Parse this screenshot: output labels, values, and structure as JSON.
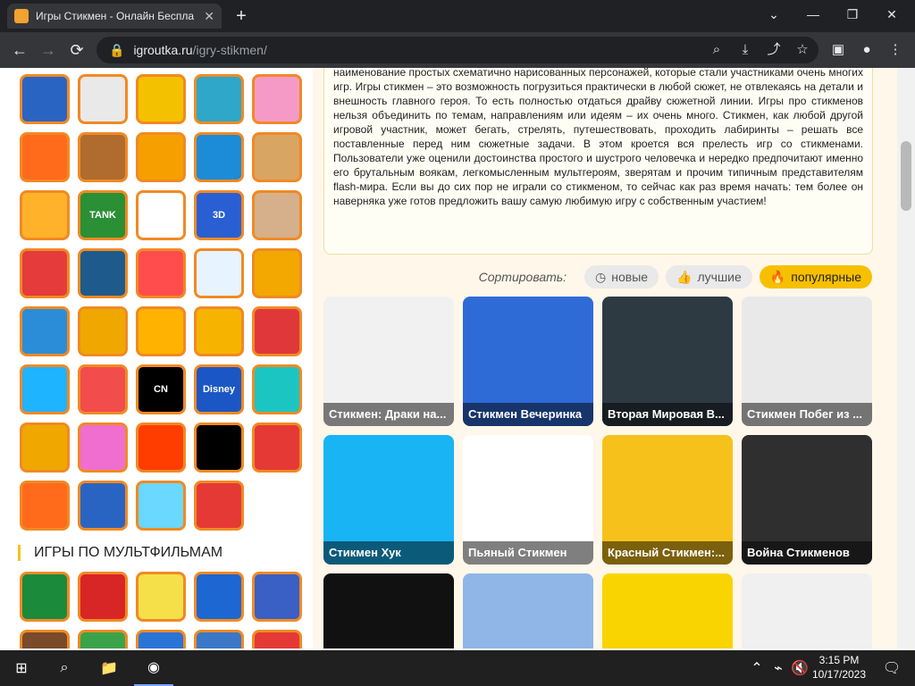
{
  "browser": {
    "tab_title": "Игры Стикмен - Онлайн Беспла",
    "url_host": "igroutka.ru",
    "url_path": "/igry-stikmen/"
  },
  "left": {
    "section_title": "ИГРЫ ПО МУЛЬТФИЛЬМАМ",
    "tiles": [
      {
        "label": "",
        "color": "#2a64c3"
      },
      {
        "label": "",
        "color": "#e9e9e9"
      },
      {
        "label": "",
        "color": "#f4c100"
      },
      {
        "label": "",
        "color": "#2ea7c9"
      },
      {
        "label": "",
        "color": "#f59ac7"
      },
      {
        "label": "",
        "color": "#ff6b1a"
      },
      {
        "label": "",
        "color": "#b06b2e"
      },
      {
        "label": "",
        "color": "#f5a000"
      },
      {
        "label": "",
        "color": "#1c8bd8"
      },
      {
        "label": "",
        "color": "#d9a563"
      },
      {
        "label": "",
        "color": "#ffb22a"
      },
      {
        "label": "TANK",
        "color": "#2b8f35"
      },
      {
        "label": "",
        "color": "#fff"
      },
      {
        "label": "3D",
        "color": "#2a5fd4"
      },
      {
        "label": "",
        "color": "#d6b08a"
      },
      {
        "label": "",
        "color": "#e53b3b"
      },
      {
        "label": "",
        "color": "#1f5a8c"
      },
      {
        "label": "",
        "color": "#ff4d4d"
      },
      {
        "label": "",
        "color": "#e7f3ff"
      },
      {
        "label": "",
        "color": "#f2a800"
      },
      {
        "label": "",
        "color": "#2b8dd8"
      },
      {
        "label": "",
        "color": "#f0a800"
      },
      {
        "label": "",
        "color": "#ffb300"
      },
      {
        "label": "",
        "color": "#f6b400"
      },
      {
        "label": "",
        "color": "#e0373a"
      },
      {
        "label": "",
        "color": "#1fb4ff"
      },
      {
        "label": "",
        "color": "#f24c4c"
      },
      {
        "label": "CN",
        "color": "#000"
      },
      {
        "label": "Disney",
        "color": "#1b57c4"
      },
      {
        "label": "",
        "color": "#1bc6c2"
      },
      {
        "label": "",
        "color": "#f0a800"
      },
      {
        "label": "",
        "color": "#f06ecf"
      },
      {
        "label": "",
        "color": "#ff3d00"
      },
      {
        "label": "",
        "color": "#000"
      },
      {
        "label": "",
        "color": "#e53935"
      },
      {
        "label": "",
        "color": "#ff6b1a"
      },
      {
        "label": "",
        "color": "#2a64c3"
      },
      {
        "label": "",
        "color": "#6ad8ff"
      },
      {
        "label": "",
        "color": "#e53935"
      }
    ],
    "tiles2": [
      {
        "label": "",
        "color": "#1b8a3a"
      },
      {
        "label": "",
        "color": "#d82525"
      },
      {
        "label": "",
        "color": "#f6e04a"
      },
      {
        "label": "",
        "color": "#1c67d1"
      },
      {
        "label": "",
        "color": "#3a5fc5"
      },
      {
        "label": "",
        "color": "#7a4a2a"
      },
      {
        "label": "",
        "color": "#3aa34a"
      },
      {
        "label": "",
        "color": "#2a74d6"
      },
      {
        "label": "",
        "color": "#3a77c7"
      },
      {
        "label": "",
        "color": "#e53935"
      }
    ]
  },
  "descr": {
    "text": "наименование простых схематично нарисованных персонажей, которые стали участниками очень многих игр. Игры стикмен – это возможность погрузиться практически в любой сюжет, не отвлекаясь на детали и внешность главного героя. То есть полностью отдаться драйву сюжетной линии. Игры про стикменов нельзя объединить по темам, направлениям или идеям – их очень много. Стикмен, как любой другой игровой участник, может бегать, стрелять, путешествовать, проходить лабиринты – решать все поставленные перед ним сюжетные задачи. В этом кроется вся прелесть игр со стикменами. Пользователи уже оценили достоинства простого и шустрого человечка и нередко предпочитают именно его брутальным воякам, легкомысленным мультгероям, зверятам и прочим типичным представителям flash-мира. Если вы до сих пор не играли со стикменом, то сейчас как раз время начать: тем более он наверняка уже готов предложить вашу самую любимую игру с собственным участием!"
  },
  "sort": {
    "label": "Сортировать:",
    "options": [
      {
        "label": "новые",
        "icon": "clock-icon",
        "active": false
      },
      {
        "label": "лучшие",
        "icon": "thumbs-up-icon",
        "active": false
      },
      {
        "label": "популярные",
        "icon": "fire-icon",
        "active": true
      }
    ]
  },
  "cards": [
    {
      "title": "Стикмен: Драки на...",
      "bg": "#f1f1f1"
    },
    {
      "title": "Стикмен Вечеринка",
      "bg": "#2f6bd6"
    },
    {
      "title": "Вторая Мировая В...",
      "bg": "#2e3a42"
    },
    {
      "title": "Стикмен Побег из ...",
      "bg": "#e9e9e9"
    },
    {
      "title": "Стикмен Хук",
      "bg": "#19b4f4"
    },
    {
      "title": "Пьяный Стикмен",
      "bg": "#fff"
    },
    {
      "title": "Красный Стикмен:...",
      "bg": "#f6c11b"
    },
    {
      "title": "Война Стикменов",
      "bg": "#2f2f2f"
    },
    {
      "title": "",
      "bg": "#111"
    },
    {
      "title": "",
      "bg": "#8fb6e6"
    },
    {
      "title": "",
      "bg": "#f9d400"
    },
    {
      "title": "",
      "bg": "#f0f0f0"
    }
  ],
  "taskbar": {
    "time": "3:15 PM",
    "date": "10/17/2023"
  }
}
